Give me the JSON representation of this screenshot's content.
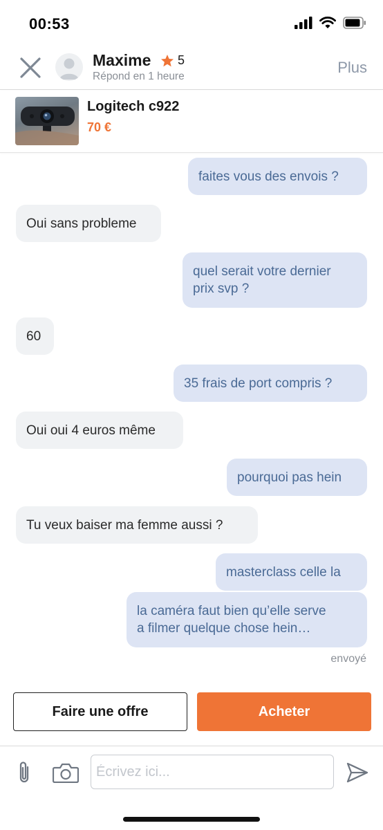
{
  "status_bar": {
    "time": "00:53"
  },
  "header": {
    "name": "Maxime",
    "rating": "5",
    "response_time": "Répond en 1 heure",
    "more_label": "Plus"
  },
  "product": {
    "title": "Logitech c922",
    "price": "70 €"
  },
  "messages": [
    {
      "from": "me",
      "text": "faites vous des envois ?"
    },
    {
      "from": "them",
      "text": "Oui sans probleme"
    },
    {
      "from": "me",
      "text": "quel serait votre dernier\nprix svp ?"
    },
    {
      "from": "them",
      "text": "60"
    },
    {
      "from": "me",
      "text": "35 frais de port compris ?"
    },
    {
      "from": "them",
      "text": "Oui oui 4 euros même"
    },
    {
      "from": "me",
      "text": "pourquoi pas hein"
    },
    {
      "from": "them",
      "text": "Tu veux baiser ma femme aussi ?"
    },
    {
      "from": "me",
      "text": "masterclass celle la"
    },
    {
      "from": "me",
      "text": "la caméra faut bien qu’elle serve\na filmer quelque chose hein…"
    }
  ],
  "sent_status": "envoyé",
  "actions": {
    "offer_label": "Faire une offre",
    "buy_label": "Acheter"
  },
  "composer": {
    "placeholder": "Écrivez ici..."
  },
  "colors": {
    "accent": "#ef7436",
    "outgoing_bubble": "#dde4f4",
    "outgoing_text": "#4a6a95",
    "incoming_bubble": "#f0f2f4"
  },
  "icons": [
    "signal-icon",
    "wifi-icon",
    "battery-icon",
    "close-icon",
    "avatar-icon",
    "star-icon",
    "paperclip-icon",
    "camera-icon",
    "send-icon"
  ]
}
